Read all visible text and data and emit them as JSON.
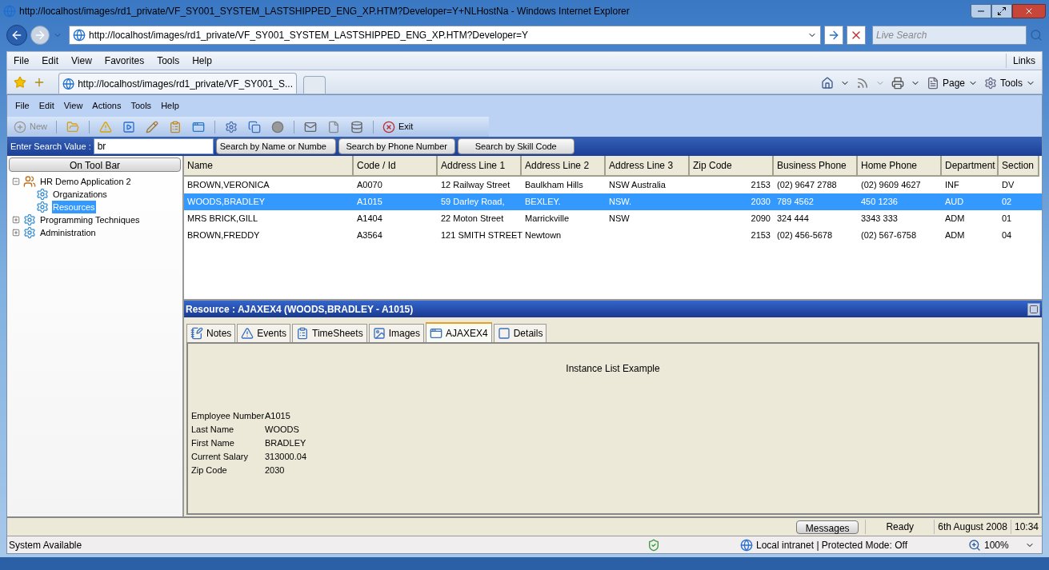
{
  "browser": {
    "title": "http://localhost/images/rd1_private/VF_SY001_SYSTEM_LASTSHIPPED_ENG_XP.HTM?Developer=Y+NLHostNa - Windows Internet Explorer",
    "address": "http://localhost/images/rd1_private/VF_SY001_SYSTEM_LASTSHIPPED_ENG_XP.HTM?Developer=Y",
    "search_placeholder": "Live Search",
    "menu": [
      "File",
      "Edit",
      "View",
      "Favorites",
      "Tools",
      "Help"
    ],
    "links": "Links",
    "tab_title": "http://localhost/images/rd1_private/VF_SY001_S...",
    "commands": [
      "Page",
      "Tools"
    ]
  },
  "app": {
    "menu": [
      "File",
      "Edit",
      "View",
      "Actions",
      "Tools",
      "Help"
    ],
    "toolbar": {
      "new_label": "New",
      "new_disabled": true,
      "exit_label": "Exit"
    },
    "search": {
      "label": "Enter Search Value :",
      "value": "br",
      "buttons": [
        "Search by Name or Numbe",
        "Search by Phone Number",
        "Search by Skill Code"
      ]
    },
    "tree": {
      "header": "On Tool Bar",
      "items": [
        {
          "label": "HR Demo Application 2",
          "expanded": true,
          "selected": false,
          "children": [
            {
              "label": "Organizations",
              "selected": false
            },
            {
              "label": "Resources",
              "selected": true
            }
          ]
        },
        {
          "label": "Programming Techniques",
          "expanded": false,
          "selected": false
        },
        {
          "label": "Administration",
          "expanded": false,
          "selected": false
        }
      ]
    },
    "table": {
      "columns": [
        "Name",
        "Code / Id",
        "Address Line 1",
        "Address Line 2",
        "Address Line 3",
        "Zip Code",
        "Business Phone",
        "Home Phone",
        "Department",
        "Section"
      ],
      "rows": [
        {
          "cells": [
            "BROWN,VERONICA",
            "A0070",
            "12 Railway Street",
            "Baulkham Hills",
            "NSW Australia",
            "2153",
            "(02) 9647 2788",
            "(02) 9609 4627",
            "INF",
            "DV"
          ],
          "selected": false
        },
        {
          "cells": [
            "WOODS,BRADLEY",
            "A1015",
            "59 Darley Road,",
            "BEXLEY.",
            "NSW.",
            "2030",
            "789 4562",
            "450 1236",
            "AUD",
            "02"
          ],
          "selected": true
        },
        {
          "cells": [
            "MRS BRICK,GILL",
            "A1404",
            "22 Moton Street",
            "Marrickville",
            "NSW",
            "2090",
            "324 444",
            "3343 333",
            "ADM",
            "01"
          ],
          "selected": false
        },
        {
          "cells": [
            "BROWN,FREDDY",
            "A3564",
            "121 SMITH STREET",
            "Newtown",
            "",
            "2153",
            "(02) 456-5678",
            "(02) 567-6758",
            "ADM",
            "04"
          ],
          "selected": false
        }
      ]
    },
    "detail": {
      "title": "Resource : AJAXEX4 (WOODS,BRADLEY - A1015)",
      "tabs": [
        {
          "label": "Notes",
          "selected": false
        },
        {
          "label": "Events",
          "selected": false
        },
        {
          "label": "TimeSheets",
          "selected": false
        },
        {
          "label": "Images",
          "selected": false
        },
        {
          "label": "AJAXEX4",
          "selected": true
        },
        {
          "label": "Details",
          "selected": false
        }
      ],
      "heading": "Instance List Example",
      "fields": [
        {
          "label": "Employee Number",
          "value": "A1015"
        },
        {
          "label": "Last Name",
          "value": "WOODS"
        },
        {
          "label": "First Name",
          "value": "BRADLEY"
        },
        {
          "label": "Current Salary",
          "value": "313000.04"
        },
        {
          "label": "Zip Code",
          "value": "2030"
        }
      ]
    },
    "status": {
      "messages_button": "Messages",
      "state": "Ready",
      "date": "6th August 2008",
      "time": "10:34"
    }
  },
  "status_bar": {
    "text": "System Available",
    "zone": "Local intranet | Protected Mode: Off",
    "zoom": "100%"
  }
}
